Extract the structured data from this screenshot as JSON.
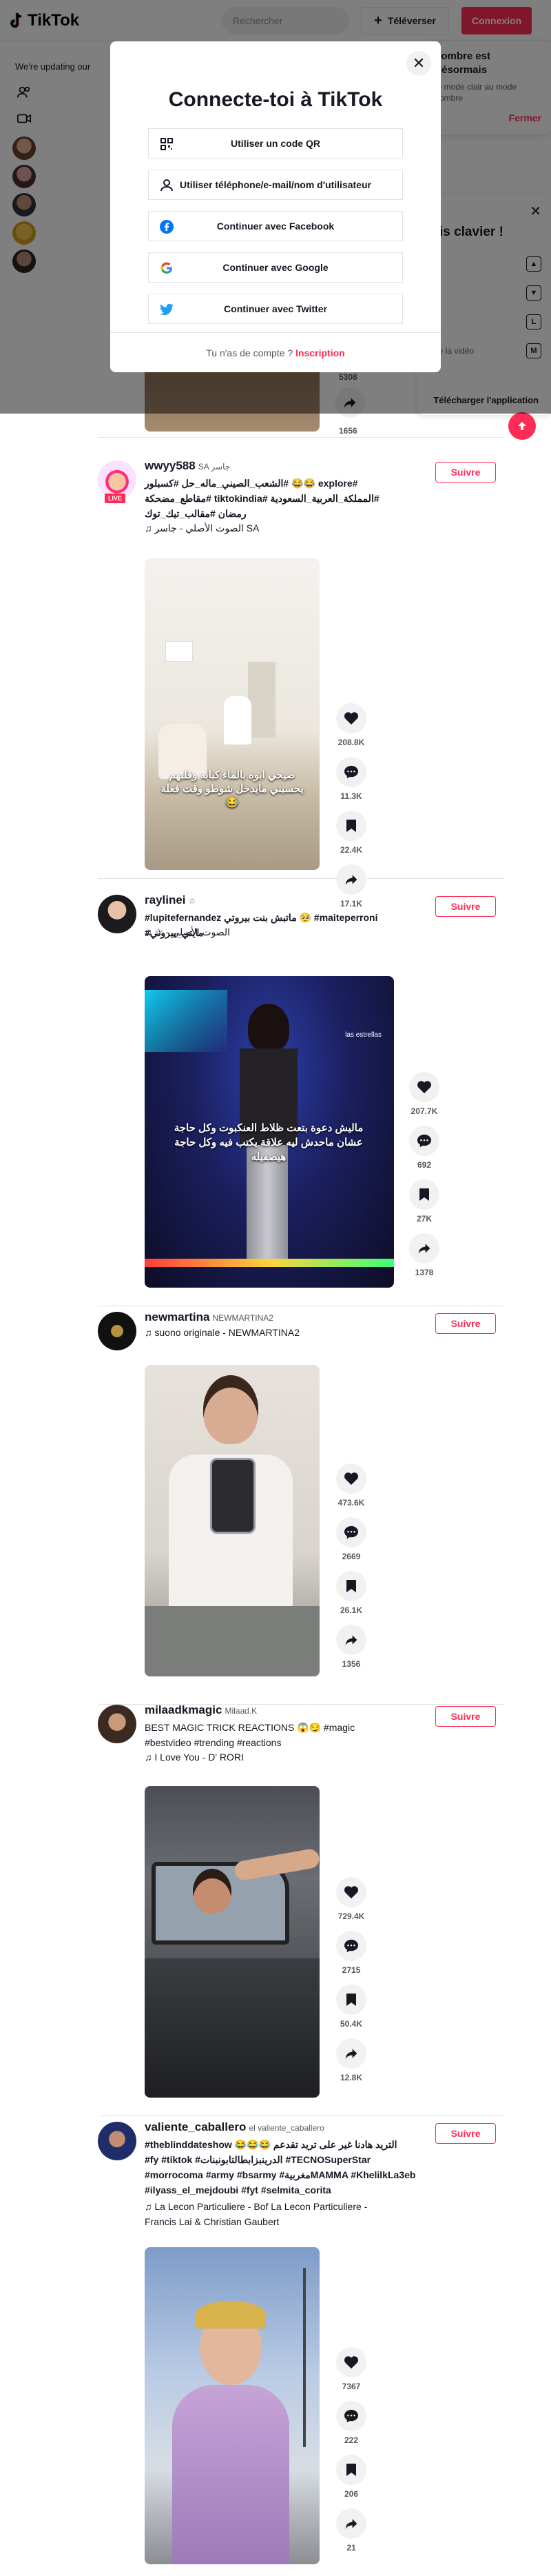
{
  "header": {
    "logo_text": "TikTok",
    "search_placeholder": "Rechercher",
    "upload_label": "Téléverser",
    "login_label": "Connexion"
  },
  "notice": {
    "text": "We're updating our"
  },
  "dark_mode_card": {
    "title": "sombre est désormais",
    "body": "le mode clair au mode sombre",
    "close_label": "Fermer"
  },
  "keyboard_card": {
    "title": "rcis clavier !",
    "download_label": "Télécharger l'application",
    "rows": [
      {
        "label": "",
        "key": "▲"
      },
      {
        "label": "r",
        "key": "▼"
      },
      {
        "label": "",
        "key": "L"
      },
      {
        "label": "n de la vidéo",
        "key": "M"
      }
    ]
  },
  "modal": {
    "title": "Connecte-toi à TikTok",
    "options": [
      {
        "label": "Utiliser un code QR",
        "icon": "qr-code-icon"
      },
      {
        "label": "Utiliser téléphone/e-mail/nom d'utilisateur",
        "icon": "person-icon"
      },
      {
        "label": "Continuer avec Facebook",
        "icon": "facebook-icon"
      },
      {
        "label": "Continuer avec Google",
        "icon": "google-icon"
      },
      {
        "label": "Continuer avec Twitter",
        "icon": "twitter-icon"
      }
    ],
    "footer_text": "Tu n'as de compte ?",
    "footer_link": "Inscription"
  },
  "partial_post": {
    "counts": [
      "5308",
      "1656"
    ]
  },
  "posts": [
    {
      "username": "wwyy588",
      "nickname": "SA جاسر",
      "live": "LIVE",
      "caption_lines": [
        "#explore 😂😂 #الشعب_الصيني_ماله_حل #كسبلور",
        "#المملكة_العربية_السعودية #tiktokindia #مقاطع_مضحكة",
        "رمضان #مقالب_تيك_توك"
      ],
      "music": "الصوت الأصلي - جاسر SA",
      "video_text": "صيحي ابوه بالماء كبابه وقلبهم يحسبني مايدخل شوطو وقت فعلة 😂",
      "counts": [
        "208.8K",
        "11.3K",
        "22.4K",
        "17.1K"
      ],
      "follow_label": "Suivre"
    },
    {
      "username": "raylinei",
      "nickname": "☆",
      "caption_lines": [
        "#lupitefernandez ماتبش بنت بيروتي 🥺 #maiteperroni #مايتي_بيروني"
      ],
      "music": "☆ - الصوت الأصلي",
      "video_text": "ماليش دعوة بتعت ظلاط العنكبوت وكل حاجة عشان ماحدش ليه علاقة يكتب فيه وكل حاجة هيصفيله",
      "video_brand": "las estrellas",
      "counts": [
        "207.7K",
        "692",
        "27K",
        "1378"
      ],
      "follow_label": "Suivre"
    },
    {
      "username": "newmartina",
      "nickname": "NEWMARTINA2",
      "caption_lines": [],
      "music": "suono originale - NEWMARTINA2",
      "counts": [
        "473.6K",
        "2669",
        "26.1K",
        "1356"
      ],
      "follow_label": "Suivre"
    },
    {
      "username": "milaadkmagic",
      "nickname": "Milaad.K",
      "caption_lines": [
        "BEST MAGIC TRICK REACTIONS 😱😏 #magic",
        "#bestvideo #trending #reactions"
      ],
      "music": "I Love You - D' RORI",
      "counts": [
        "729.4K",
        "2715",
        "50.4K",
        "12.8K"
      ],
      "follow_label": "Suivre"
    },
    {
      "username": "valiente_caballero",
      "nickname": "el valiente_caballero",
      "caption_lines": [
        "#theblinddateshow 😂😂😂 التريد هادنا غير على تريد تقدعم",
        "#fy #tiktok #الدرينبزابطالتابونبنات #TECNOSuperStar",
        "#morrocoma #army #bsarmy #مغربيةMAMMA #KhelilkLa3eb",
        "#ilyass_el_mejdoubi #fyt #selmita_corita"
      ],
      "music_lines": [
        "La Lecon Particuliere - Bof La Lecon Particuliere -",
        "Francis Lai & Christian Gaubert"
      ],
      "counts": [
        "7367",
        "222",
        "206",
        "21"
      ],
      "follow_label": "Suivre"
    }
  ]
}
